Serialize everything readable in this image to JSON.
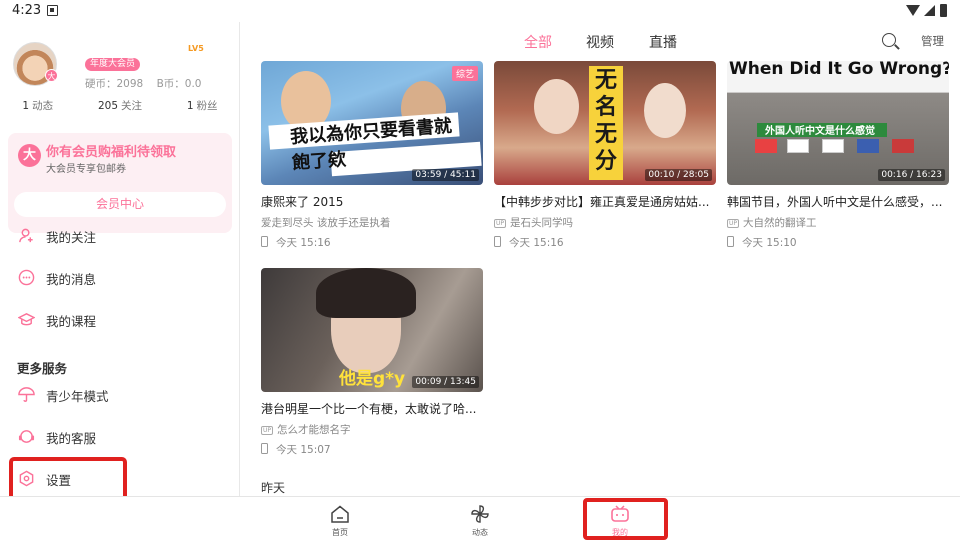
{
  "status_bar": {
    "time": "4:23"
  },
  "profile": {
    "vip_tag": "年度大会员",
    "level_tag": "LV5",
    "hard_coins": "硬币：2098",
    "b_coins": "B币：0.0",
    "dynamics_count": "1",
    "dynamics_label": "动态",
    "following_count": "205",
    "following_label": "关注",
    "fans_count": "1",
    "fans_label": "粉丝"
  },
  "vip_card": {
    "logo": "大",
    "title": "你有会员购福利待领取",
    "subtitle": "大会员专享包邮券",
    "button": "会员中心"
  },
  "menu": {
    "items": [
      {
        "label": "我的关注",
        "icon": "person-add-icon"
      },
      {
        "label": "我的消息",
        "icon": "chat-icon"
      },
      {
        "label": "我的课程",
        "icon": "graduation-cap-icon"
      }
    ],
    "section_title": "更多服务",
    "services": [
      {
        "label": "青少年模式",
        "icon": "umbrella-icon"
      },
      {
        "label": "我的客服",
        "icon": "headset-icon"
      },
      {
        "label": "设置",
        "icon": "settings-hexagon-icon"
      }
    ]
  },
  "header": {
    "tabs": [
      "全部",
      "视频",
      "直播"
    ],
    "active_tab": "全部",
    "manage": "管理"
  },
  "videos": [
    {
      "title": "康熙来了 2015",
      "uploader": "爱走到尽头 该放手还是执着",
      "time": "今天 15:16",
      "duration": "03:59 / 45:11",
      "tag": "综艺",
      "caption": "我以為你只要看書就飽了欸",
      "show_up_icon": false
    },
    {
      "title": "【中韩步步对比】雍正真爱是通房姑姑...",
      "uploader": "是石头同学吗",
      "time": "今天 15:16",
      "duration": "00:10 / 28:05",
      "caption": "无名无分",
      "show_up_icon": true
    },
    {
      "title": "韩国节目，外国人听中文是什么感受，...",
      "uploader": "大自然的翻译工",
      "time": "今天 15:10",
      "duration": "00:16 / 16:23",
      "caption": "When Did It Go Wrong?",
      "caption2": "外国人听中文是什么感觉",
      "show_up_icon": true
    },
    {
      "title": "港台明星一个比一个有梗，太敢说了哈...",
      "uploader": "怎么才能想名字",
      "time": "今天 15:07",
      "duration": "00:09 / 13:45",
      "caption": "他是g*y",
      "show_up_icon": true
    }
  ],
  "section_yesterday": "昨天",
  "bottom_nav": [
    {
      "label": "首页",
      "icon": "home-icon"
    },
    {
      "label": "动态",
      "icon": "pinwheel-icon"
    },
    {
      "label": "我的",
      "icon": "tv-icon",
      "active": true
    }
  ],
  "colors": {
    "accent": "#fb7299",
    "highlight_box": "#e0211f"
  }
}
